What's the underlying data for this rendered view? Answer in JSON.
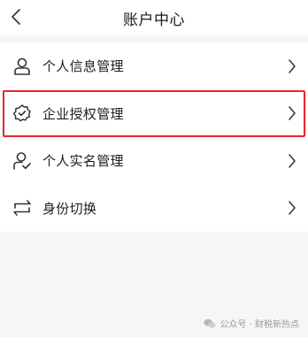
{
  "header": {
    "title": "账户中心",
    "back_icon": "chevron-left-icon"
  },
  "menu": {
    "items": [
      {
        "label": "个人信息管理",
        "icon": "user-icon"
      },
      {
        "label": "企业授权管理",
        "icon": "badge-check-icon",
        "highlighted": true
      },
      {
        "label": "个人实名管理",
        "icon": "user-verified-icon"
      },
      {
        "label": "身份切换",
        "icon": "switch-arrows-icon"
      }
    ]
  },
  "watermark": {
    "text": "公众号 · 财税新热点",
    "icon": "wechat-icon"
  },
  "colors": {
    "highlight": "#e5262b",
    "background": "#f5f6f8",
    "card": "#ffffff"
  }
}
